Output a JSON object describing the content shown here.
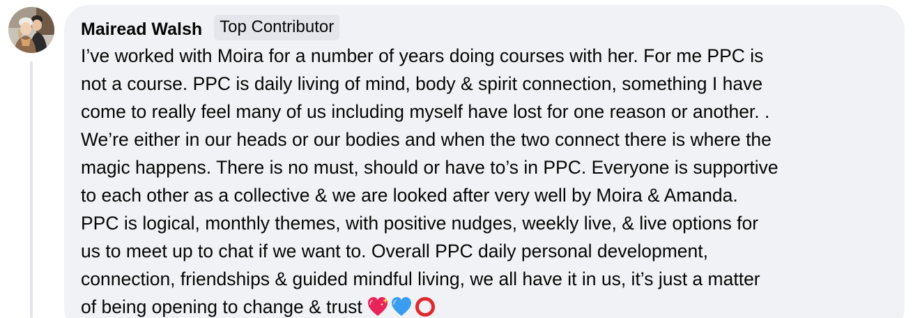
{
  "comment": {
    "author": "Mairead Walsh",
    "badge": "Top Contributor",
    "lines": [
      "I’ve worked with Moira for a number of years doing courses with her. For me PPC is",
      "not a course. PPC is daily living of mind, body & spirit connection, something I have",
      "come to really feel many of us including myself have lost for one reason or another. .",
      "We’re either in our heads or our bodies and when the two connect there is where the",
      "magic happens. There is no must, should or have to’s in PPC. Everyone is supportive",
      "to each other as a collective & we are looked after very well by Moira & Amanda.",
      "PPC is logical, monthly themes, with positive nudges, weekly live, & live options for",
      "us to meet up to chat if we want to. Overall PPC daily personal development,",
      "connection, friendships & guided mindful living, we all have it in us, it’s just a matter",
      "of being opening to change & trust"
    ],
    "emojis": [
      "sparkling-heart",
      "blue-heart",
      "hollow-red-circle"
    ]
  },
  "colors": {
    "bubble": "#f0f2f5",
    "badge": "#e4e6eb",
    "thread_line": "#e4e6eb",
    "text": "#050505"
  }
}
